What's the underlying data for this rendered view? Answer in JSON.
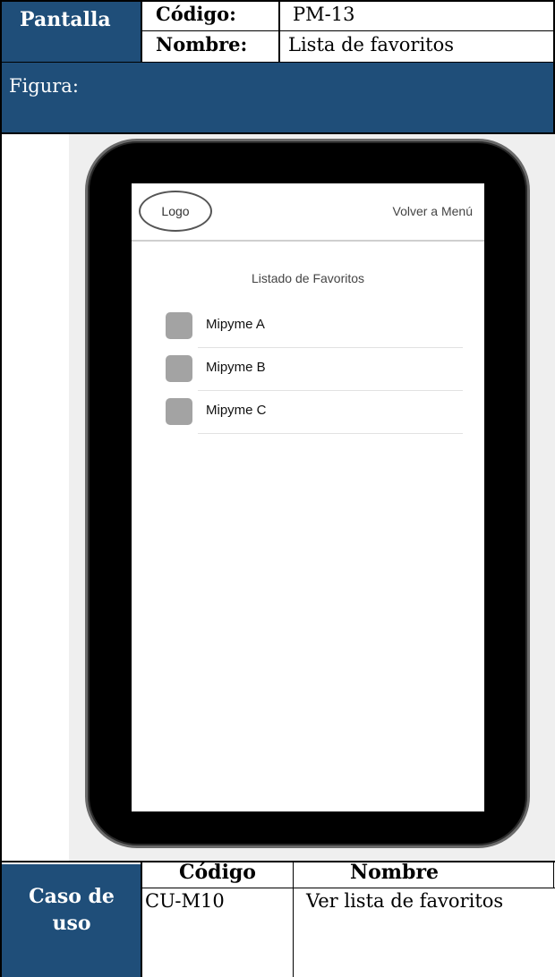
{
  "header": {
    "pantalla_label": "Pantalla",
    "codigo_label": "Código:",
    "codigo_value": "PM-13",
    "nombre_label": "Nombre:",
    "nombre_value": "Lista de favoritos"
  },
  "figure": {
    "label": "Figura:"
  },
  "mockup": {
    "logo": "Logo",
    "back_link": "Volver a Menú",
    "list_title": "Listado de Favoritos",
    "items": [
      {
        "label": "Mipyme A"
      },
      {
        "label": "Mipyme B"
      },
      {
        "label": "Mipyme C"
      }
    ]
  },
  "use_case": {
    "label_line1": "Caso de",
    "label_line2": "uso",
    "codigo_header": "Código",
    "nombre_header": "Nombre",
    "codigo_value": "CU-M10",
    "nombre_value": "Ver lista de favoritos"
  },
  "colors": {
    "header_blue": "#1f4e79",
    "figure_bg": "#efefef",
    "placeholder_gray": "#a3a3a3"
  }
}
